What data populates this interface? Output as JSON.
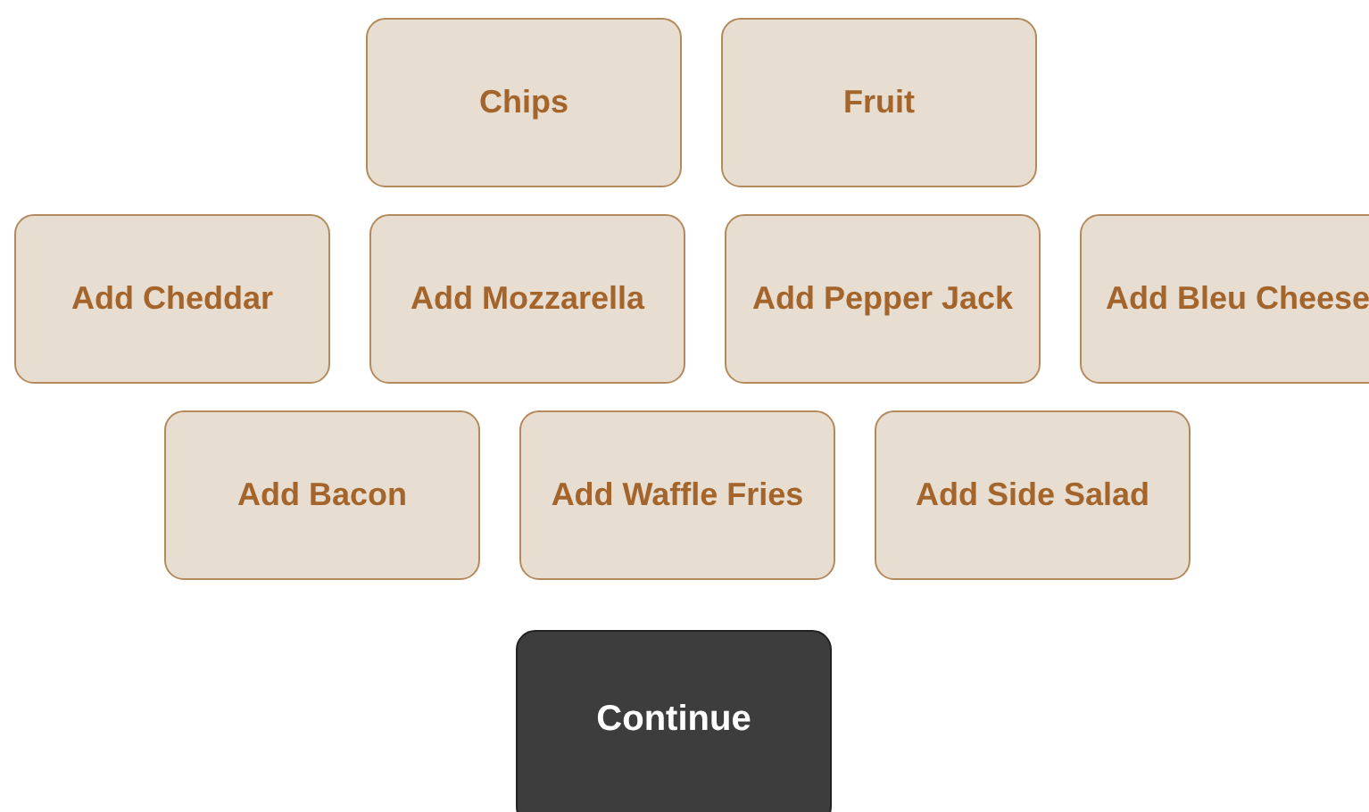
{
  "option_rows": [
    {
      "items": [
        "Chips",
        "Fruit"
      ]
    },
    {
      "items": [
        "Add Cheddar",
        "Add Mozzarella",
        "Add Pepper Jack",
        "Add Bleu Cheese"
      ]
    },
    {
      "items": [
        "Add Bacon",
        "Add Waffle Fries",
        "Add Side Salad"
      ]
    }
  ],
  "continue_button": "Continue"
}
